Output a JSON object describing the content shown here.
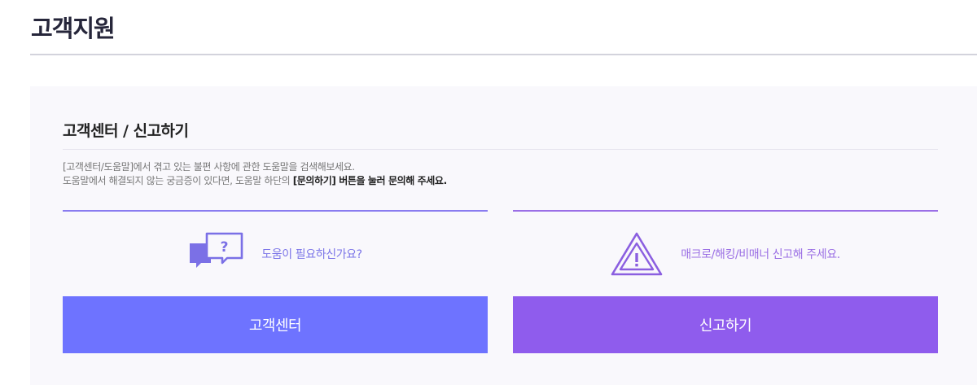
{
  "page": {
    "title": "고객지원"
  },
  "section": {
    "title": "고객센터 / 신고하기",
    "desc_line1": "[고객센터/도움말]에서 겪고 있는 불편 사항에 관한 도움말을 검색해보세요.",
    "desc_line2_prefix": "도움말에서 해결되지 않는 궁금증이 있다면, 도움말 하단의 ",
    "desc_line2_bold": "[문의하기] 버튼을 눌러 문의해 주세요."
  },
  "support": {
    "icon": "chat-question-icon",
    "info_text": "도움이 필요하신가요?",
    "button_label": "고객센터"
  },
  "report": {
    "icon": "warning-triangle-icon",
    "info_text": "매크로/해킹/비매너 신고해 주세요.",
    "button_label": "신고하기"
  },
  "colors": {
    "support_button": "#6e73ff",
    "report_button": "#8f5ced",
    "panel_background": "#f9f8fc"
  }
}
